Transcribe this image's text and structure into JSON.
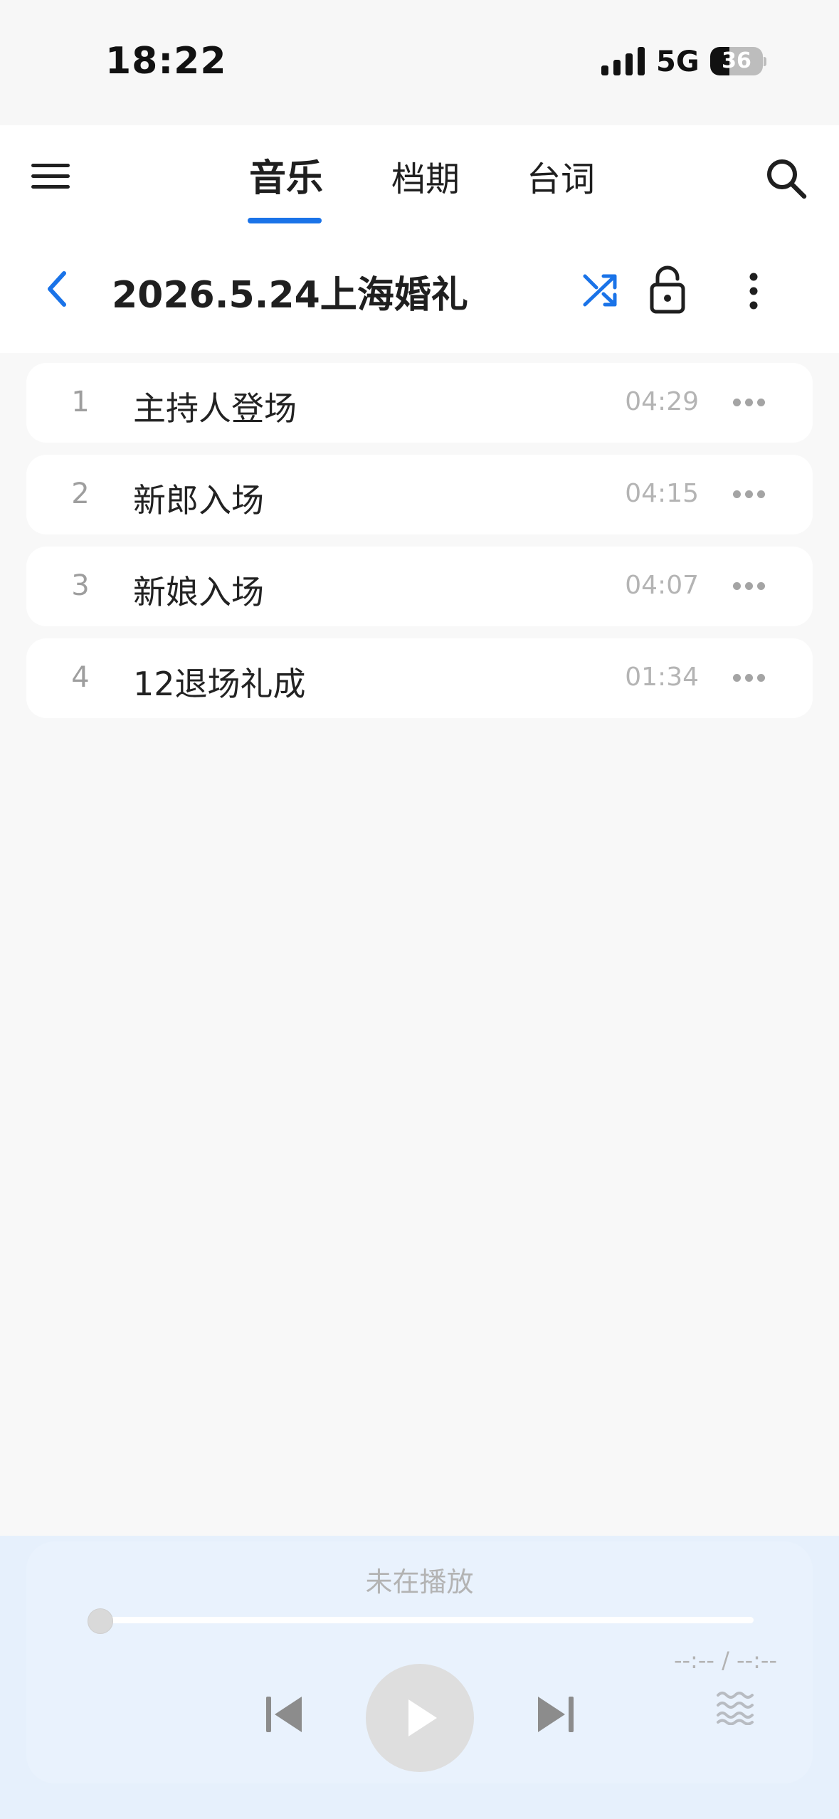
{
  "status_bar": {
    "time": "18:22",
    "network": "5G",
    "battery": "36",
    "battery_level": 0.36
  },
  "nav": {
    "tabs": [
      {
        "label": "音乐",
        "active": true
      },
      {
        "label": "档期",
        "active": false
      },
      {
        "label": "台词",
        "active": false
      }
    ],
    "icons": {
      "menu": "menu-icon",
      "search": "search-icon"
    }
  },
  "playlist": {
    "title": "2026.5.24上海婚礼",
    "icons": {
      "back": "chevron-left-icon",
      "shuffle": "shuffle-icon",
      "lock": "lock-open-icon",
      "more": "more-vertical-icon"
    }
  },
  "tracks": [
    {
      "index": "1",
      "name": "主持人登场",
      "duration": "04:29"
    },
    {
      "index": "2",
      "name": "新郎入场",
      "duration": "04:15"
    },
    {
      "index": "3",
      "name": "新娘入场",
      "duration": "04:07"
    },
    {
      "index": "4",
      "name": "12退场礼成",
      "duration": "01:34"
    }
  ],
  "player": {
    "status": "未在播放",
    "time_display": "--:-- / --:--",
    "progress": 0,
    "icons": {
      "prev": "skip-previous-icon",
      "play": "play-icon",
      "next": "skip-next-icon",
      "mode": "wave-icon"
    }
  },
  "colors": {
    "accent": "#1a73e8",
    "player_bg": "#e6f0fc",
    "page_bg": "#f8f8f8"
  }
}
